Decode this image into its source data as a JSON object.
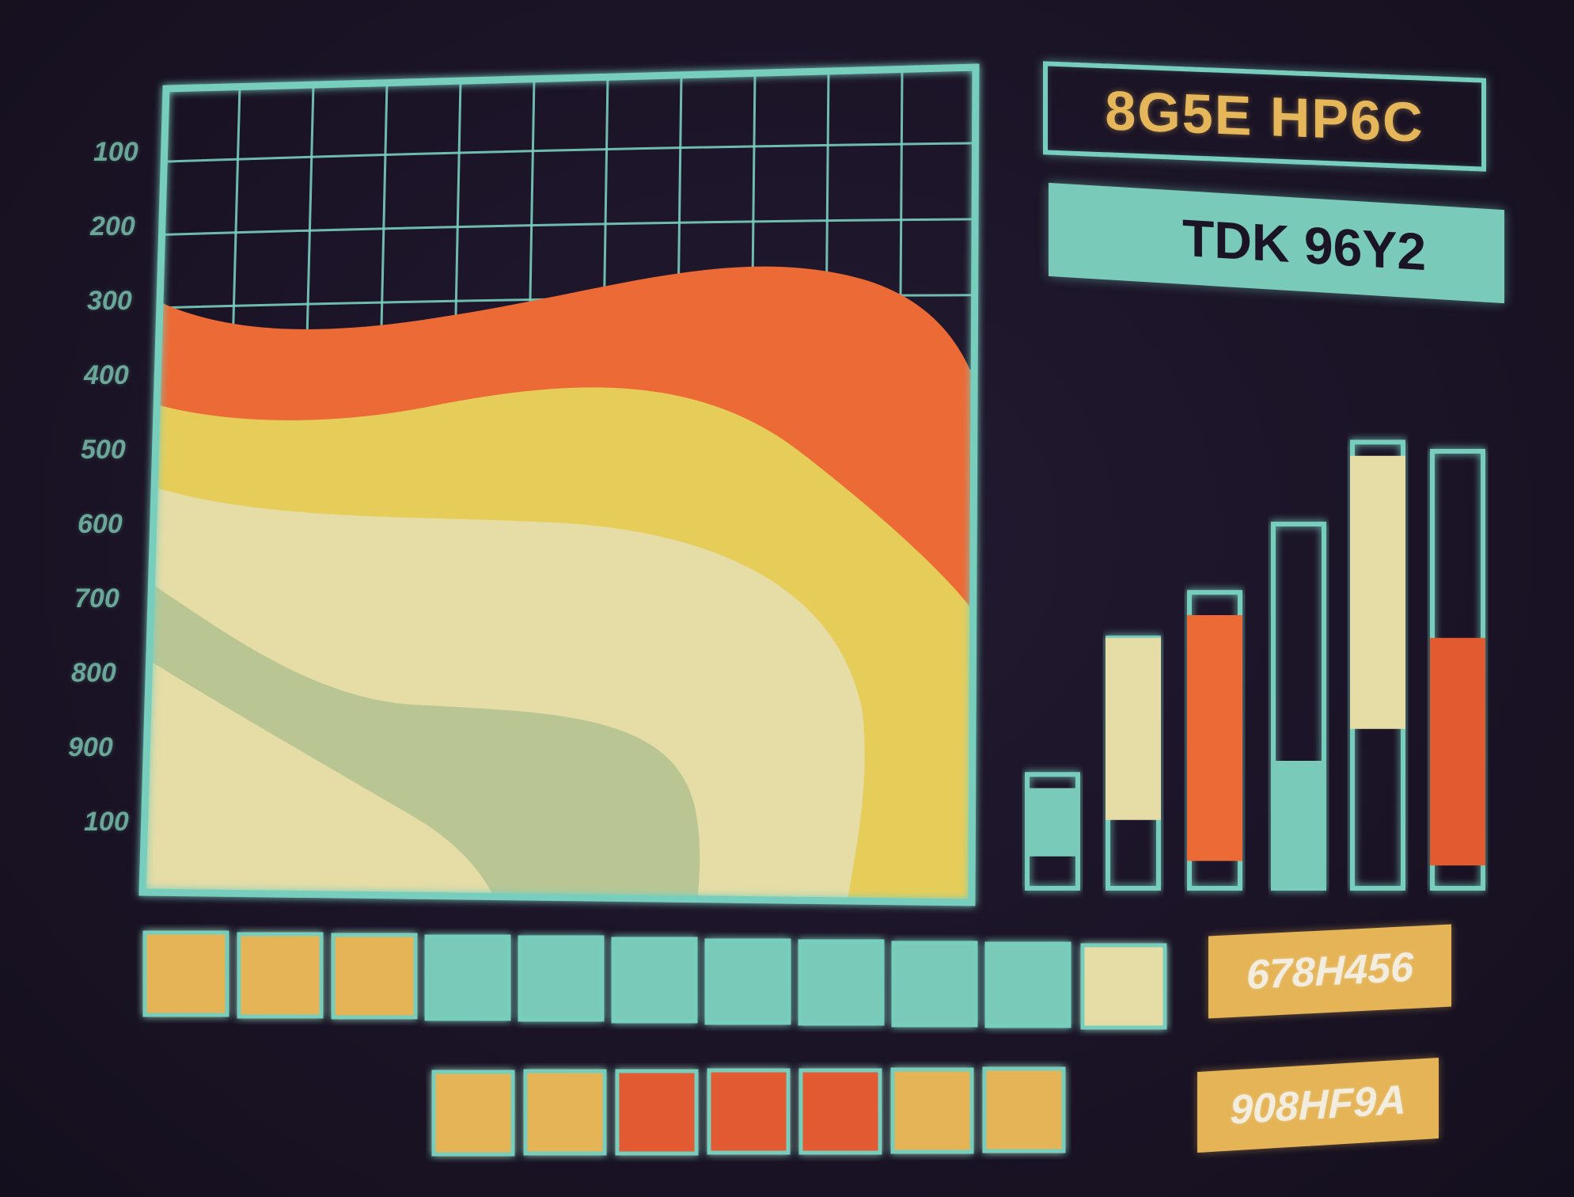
{
  "title": "8G5E HP6C",
  "subtitle": "TDK 96Y2",
  "codes": {
    "top": "678H456",
    "bottom": "908HF9A"
  },
  "colors": {
    "background": "#1b1427",
    "grid": "#78cebd",
    "orange": "#ec6a35",
    "yellow": "#e6cd5a",
    "cream": "#e5dca6",
    "sage": "#b9c694",
    "teal": "#79cab8",
    "amber": "#e5b457",
    "red": "#e25a30",
    "axis_text": "#6aa798"
  },
  "chart_data": [
    {
      "type": "area",
      "title": "",
      "xlabel": "",
      "ylabel": "",
      "y_tick_labels": [
        "100",
        "200",
        "300",
        "400",
        "500",
        "600",
        "700",
        "800",
        "900",
        "100"
      ],
      "grid": true,
      "bands": [
        {
          "color": "#ec6a35"
        },
        {
          "color": "#e6cd5a"
        },
        {
          "color": "#e5dca6"
        },
        {
          "color": "#b9c694"
        }
      ]
    },
    {
      "type": "bar",
      "title": "",
      "series": [
        {
          "track_top": 0.25,
          "fill_from": 0.07,
          "fill_to": 0.22,
          "color": "#79cab8"
        },
        {
          "track_top": 0.55,
          "fill_from": 0.15,
          "fill_to": 0.55,
          "color": "#e5dca6"
        },
        {
          "track_top": 0.65,
          "fill_from": 0.06,
          "fill_to": 0.6,
          "color": "#ec6a35"
        },
        {
          "track_top": 0.8,
          "fill_from": 0.0,
          "fill_to": 0.28,
          "color": "#79cab8"
        },
        {
          "track_top": 0.98,
          "fill_from": 0.35,
          "fill_to": 0.95,
          "color": "#e5dca6"
        },
        {
          "track_top": 0.96,
          "fill_from": 0.05,
          "fill_to": 0.55,
          "color": "#e25a30"
        }
      ]
    }
  ],
  "indicator_rows": [
    {
      "cells": [
        "#e5b457",
        "#e5b457",
        "#e5b457",
        "#79cab8",
        "#79cab8",
        "#79cab8",
        "#79cab8",
        "#79cab8",
        "#79cab8",
        "#79cab8",
        "#e5dca6"
      ]
    },
    {
      "cells": [
        "#e5b457",
        "#e5b457",
        "#e25a30",
        "#e25a30",
        "#e25a30",
        "#e5b457",
        "#e5b457"
      ]
    }
  ]
}
